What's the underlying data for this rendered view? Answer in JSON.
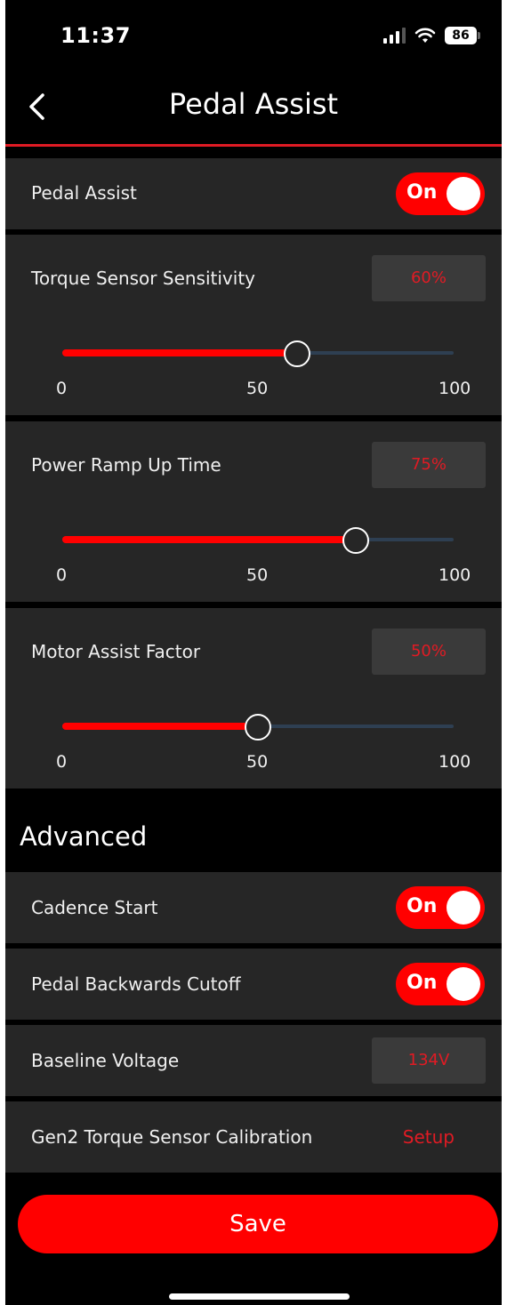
{
  "status_bar": {
    "time": "11:37",
    "battery": "86"
  },
  "header": {
    "title": "Pedal Assist"
  },
  "pedal_assist": {
    "label": "Pedal Assist",
    "toggle": "On"
  },
  "sliders": [
    {
      "label": "Torque Sensor Sensitivity",
      "value_text": "60%",
      "value": 60,
      "min_label": "0",
      "mid_label": "50",
      "max_label": "100"
    },
    {
      "label": "Power Ramp Up Time",
      "value_text": "75%",
      "value": 75,
      "min_label": "0",
      "mid_label": "50",
      "max_label": "100"
    },
    {
      "label": "Motor Assist Factor",
      "value_text": "50%",
      "value": 50,
      "min_label": "0",
      "mid_label": "50",
      "max_label": "100"
    }
  ],
  "advanced": {
    "title": "Advanced",
    "cadence_start": {
      "label": "Cadence Start",
      "toggle": "On"
    },
    "pedal_backwards_cutoff": {
      "label": "Pedal Backwards Cutoff",
      "toggle": "On"
    },
    "baseline_voltage": {
      "label": "Baseline Voltage",
      "value": "134V"
    },
    "gen2_calibration": {
      "label": "Gen2 Torque Sensor Calibration",
      "action": "Setup"
    }
  },
  "save_label": "Save",
  "colors": {
    "accent": "#ff0000",
    "card": "#262626",
    "background": "#000000",
    "track": "#2e3f52"
  }
}
